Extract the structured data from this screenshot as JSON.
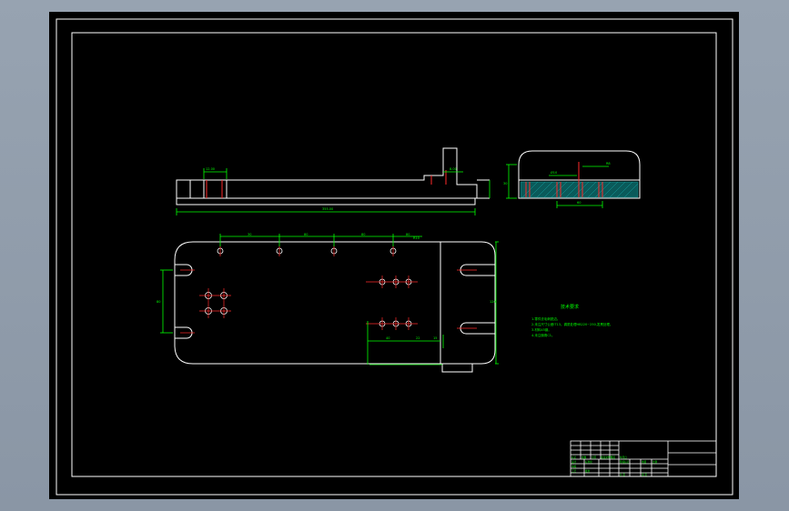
{
  "colors": {
    "background": "#000000",
    "frame": "#ffffff",
    "dimension": "#00ff00",
    "center_line": "#ff2a2a",
    "hatch": "#14a0a0",
    "annotation": "#00ff00"
  },
  "side_view": {
    "overall_length_label": "355.00",
    "slot_width_label": "12.00",
    "step_label": "8.00"
  },
  "end_view": {
    "height_label": "30",
    "top_dim_label": "R8",
    "hole_dim_label": "Ø10",
    "bottom_dim_label": "60"
  },
  "plan_view": {
    "hole_spacing": [
      "30",
      "80",
      "80",
      "80"
    ],
    "right_spacing": "R10",
    "width_label": "80",
    "height_label": "120",
    "lower_dims": [
      "40",
      "22",
      "15"
    ]
  },
  "notes": {
    "title": "技术要求",
    "lines": [
      "1.零件去毛刺锐边。",
      "2.未注尺寸公差IT13。调质处理HB220~250,发黑处理。",
      "3.材料45钢。",
      "4.未注倒角C1。"
    ]
  },
  "title_block": {
    "cells": [
      "标记",
      "处数",
      "分区",
      "更改文件号",
      "签名",
      "年月日",
      "设计",
      "标准化",
      "阶段标记",
      "重量",
      "比例",
      "审核",
      "工艺",
      "批准",
      "共 张",
      "第 张"
    ]
  }
}
